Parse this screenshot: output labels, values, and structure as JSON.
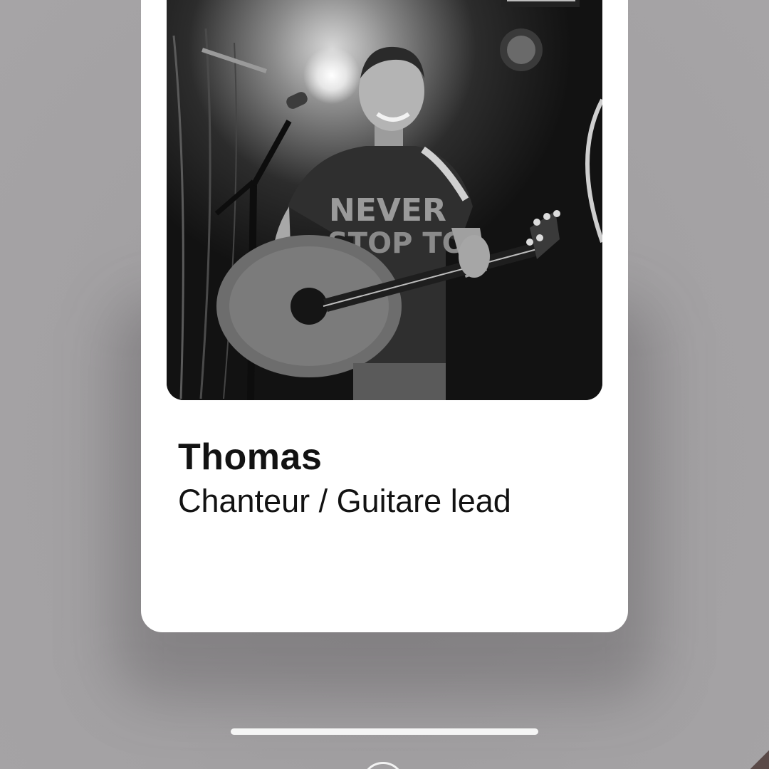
{
  "member_card": {
    "name": "Thomas",
    "role": "Chanteur / Guitare lead",
    "photo": {
      "shirt_text_line1": "NEVER",
      "shirt_text_line2": "STOP TO"
    }
  },
  "system": {
    "home_indicator_icon": "home-indicator",
    "bottom_button_icon": "circle-button-icon"
  },
  "colors": {
    "backdrop": "#a19fa1",
    "card": "#ffffff",
    "text": "#121212"
  }
}
